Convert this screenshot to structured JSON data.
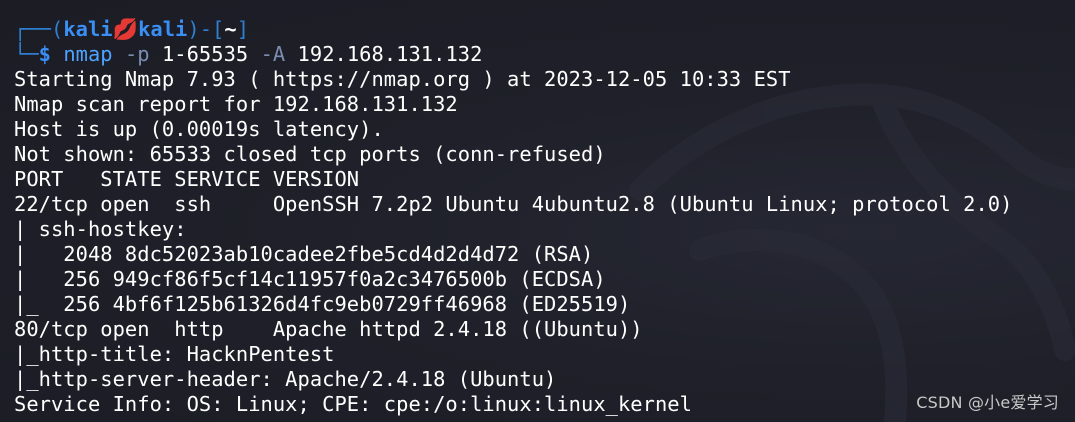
{
  "prompt": {
    "open": "┌──(",
    "user": "kali",
    "skull": "💋",
    "host": "kali",
    "close": ")-[",
    "dir": "~",
    "end": "]",
    "second_prefix": "└─",
    "dollar": "$"
  },
  "command": {
    "binary": "nmap",
    "flag1": "-p",
    "range": "1-65535",
    "flag2": "-A",
    "target": "192.168.131.132"
  },
  "output": [
    "Starting Nmap 7.93 ( https://nmap.org ) at 2023-12-05 10:33 EST",
    "Nmap scan report for 192.168.131.132",
    "Host is up (0.00019s latency).",
    "Not shown: 65533 closed tcp ports (conn-refused)",
    "PORT   STATE SERVICE VERSION",
    "22/tcp open  ssh     OpenSSH 7.2p2 Ubuntu 4ubuntu2.8 (Ubuntu Linux; protocol 2.0)",
    "| ssh-hostkey:",
    "|   2048 8dc52023ab10cadee2fbe5cd4d2d4d72 (RSA)",
    "|   256 949cf86f5cf14c11957f0a2c3476500b (ECDSA)",
    "|_  256 4bf6f125b61326d4fc9eb0729ff46968 (ED25519)",
    "80/tcp open  http    Apache httpd 2.4.18 ((Ubuntu))",
    "|_http-title: HacknPentest",
    "|_http-server-header: Apache/2.4.18 (Ubuntu)",
    "Service Info: OS: Linux; CPE: cpe:/o:linux:linux_kernel"
  ],
  "watermark": "CSDN @小e爱学习",
  "colors": {
    "background": "#1e2029",
    "prompt_blue": "#3a8ff5",
    "skull_red": "#e02b5a",
    "flag_gray": "#7a8db3",
    "text": "#ffffff"
  }
}
